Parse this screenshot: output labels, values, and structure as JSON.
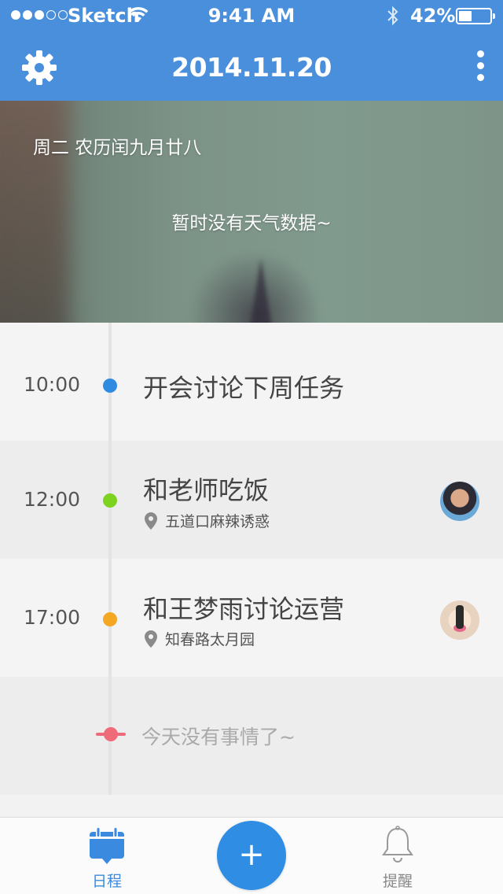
{
  "status_bar": {
    "carrier": "Sketch",
    "time": "9:41 AM",
    "battery_percent": "42%",
    "battery_level": 0.42,
    "signal_bars_filled": 3,
    "signal_bars_total": 5
  },
  "nav": {
    "title": "2014.11.20",
    "left_icon": "gear-icon",
    "right_icon": "more-vertical-icon"
  },
  "hero": {
    "date_line": "周二  农历闰九月廿八",
    "weather_text": "暂时没有天气数据~"
  },
  "timeline": {
    "events": [
      {
        "time": "10:00",
        "title": "开会讨论下周任务",
        "location": "",
        "dot_color": "#2f8be0"
      },
      {
        "time": "12:00",
        "title": "和老师吃饭",
        "location": "五道口麻辣诱惑",
        "dot_color": "#7ed321"
      },
      {
        "time": "17:00",
        "title": "和王梦雨讨论运营",
        "location": "知春路太月园",
        "dot_color": "#f5a623"
      }
    ],
    "end_text": "今天没有事情了~",
    "end_color": "#f06b7a"
  },
  "tabbar": {
    "schedule_label": "日程",
    "remind_label": "提醒",
    "add_label": "+"
  },
  "colors": {
    "header": "#4a8fdb",
    "accent": "#2f8de4"
  }
}
